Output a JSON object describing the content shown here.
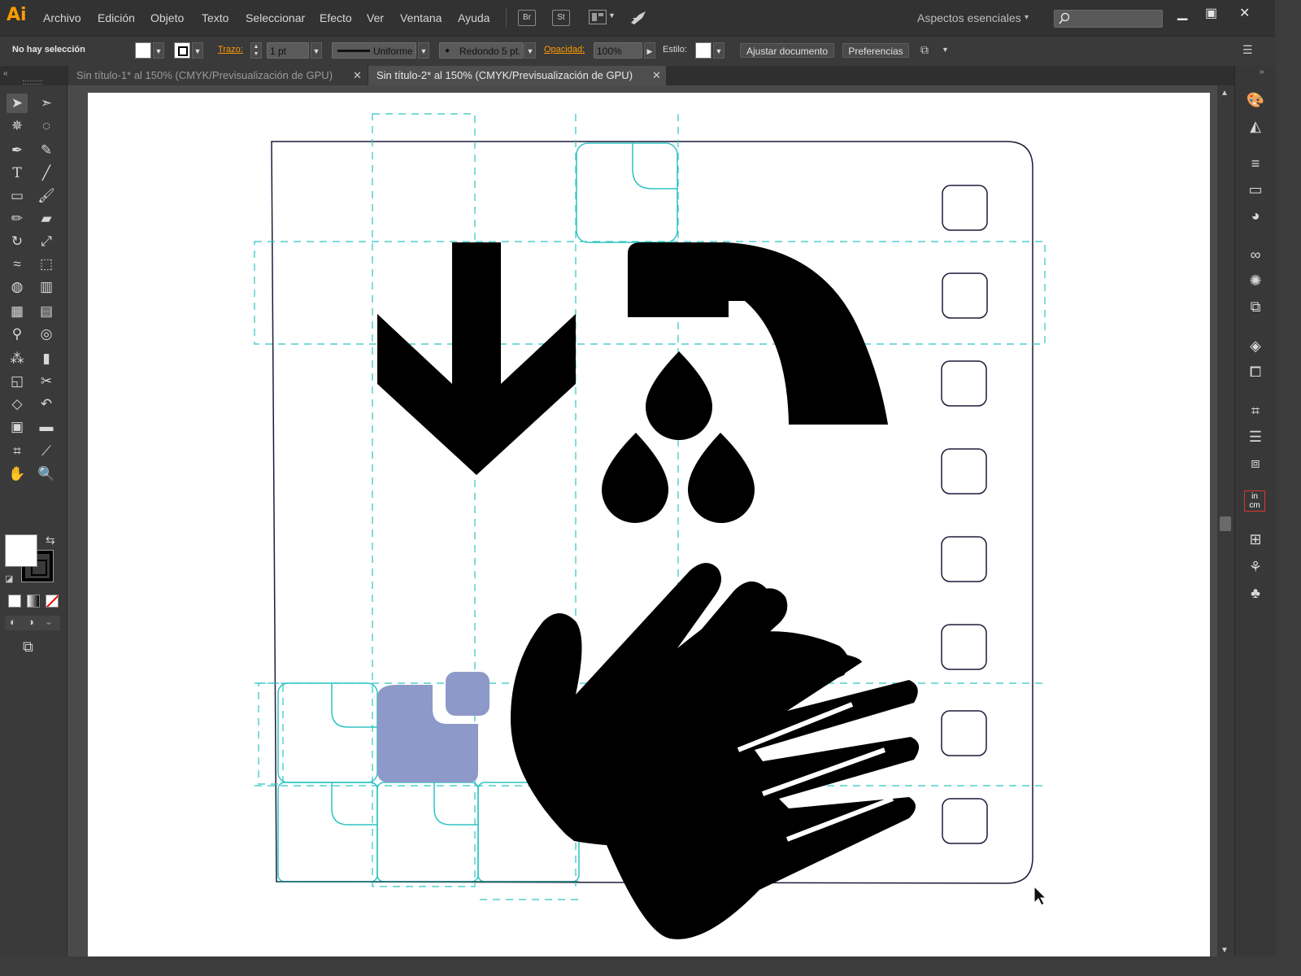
{
  "app": {
    "logo": "Ai"
  },
  "menu": [
    "Archivo",
    "Edición",
    "Objeto",
    "Texto",
    "Seleccionar",
    "Efecto",
    "Ver",
    "Ventana",
    "Ayuda"
  ],
  "bridge_buttons": [
    "Br",
    "St"
  ],
  "workspace": {
    "label": "Aspectos esenciales",
    "arrow": "▾"
  },
  "window_controls": {
    "minimize": "▁",
    "maximize": "▣",
    "close": "✕"
  },
  "control_bar": {
    "selection": "No hay selección",
    "stroke_label": "Trazo:",
    "stroke_value": "1 pt",
    "profile": "Uniforme",
    "brush": "Redondo 5 pt.",
    "opacity_label": "Opacidad:",
    "opacity_value": "100%",
    "style_label": "Estilo:",
    "document_button": "Ajustar documento",
    "preferences_button": "Preferencias"
  },
  "tabs": [
    {
      "label": "Sin título-1* al 150% (CMYK/Previsualización de GPU)",
      "active": false
    },
    {
      "label": "Sin título-2* al 150% (CMYK/Previsualización de GPU)",
      "active": true
    }
  ],
  "colors": {
    "accent": "#ff9a00",
    "guide": "#2ec4c4",
    "pictogram": "#000000",
    "swatch_blue": "#8d99c8",
    "frame": "#1c1c3a",
    "artboard": "#ffffff"
  },
  "tools": [
    "selection-icon",
    "direct-selection-icon",
    "magic-wand-icon",
    "lasso-icon",
    "pen-icon",
    "curvature-icon",
    "type-icon",
    "line-icon",
    "rectangle-icon",
    "paintbrush-icon",
    "pencil-icon",
    "eraser-icon",
    "rotate-icon",
    "scale-icon",
    "warp-icon",
    "free-transform-icon",
    "shape-builder-icon",
    "perspective-icon",
    "mesh-icon",
    "gradient-icon",
    "eyedropper-icon",
    "blend-icon",
    "symbol-sprayer-icon",
    "column-graph-icon",
    "artboard-icon",
    "slice-icon",
    "hand-icon",
    "zoom-icon"
  ],
  "right_panel_icons": [
    "color-icon",
    "color-guide-icon",
    "stroke-icon",
    "gradient-panel-icon",
    "transparency-icon",
    "cc-libraries-icon",
    "appearance-icon",
    "graphic-styles-icon",
    "layers-icon",
    "artboards-icon",
    "transform-icon",
    "align-icon",
    "pathfinder-icon",
    "units-icon",
    "grid-icon",
    "brushes-icon",
    "symbols-icon"
  ],
  "units_label_top": "in",
  "units_label_bottom": "cm"
}
